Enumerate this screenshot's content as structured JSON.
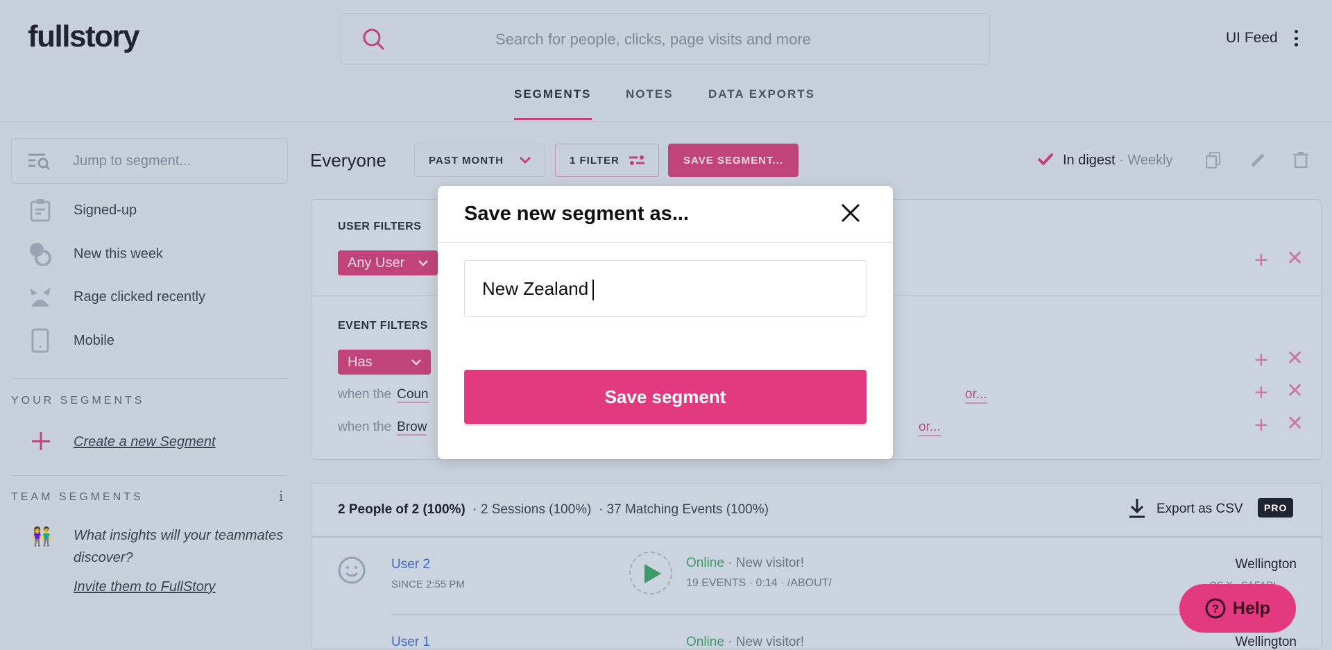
{
  "header": {
    "logo": "fullstory",
    "search_placeholder": "Search for people, clicks, page visits and more",
    "feed_label": "UI Feed"
  },
  "tabs": [
    {
      "label": "SEGMENTS",
      "active": true
    },
    {
      "label": "NOTES"
    },
    {
      "label": "DATA EXPORTS"
    }
  ],
  "sidebar": {
    "search_placeholder": "Jump to segment...",
    "items": [
      {
        "label": "Signed-up",
        "icon": "clipboard-icon"
      },
      {
        "label": "New this week",
        "icon": "baby-icon"
      },
      {
        "label": "Rage clicked recently",
        "icon": "angry-face-icon"
      },
      {
        "label": "Mobile",
        "icon": "phone-icon"
      }
    ],
    "your_segments": "YOUR SEGMENTS",
    "create_label": "Create a new Segment",
    "team_segments": "TEAM SEGMENTS",
    "info": "i",
    "team_prompt": "What insights will your teammates discover?",
    "invite_label": "Invite them to FullStory"
  },
  "segment": {
    "title": "Everyone",
    "date_range": "PAST MONTH",
    "filter_count": "1 FILTER",
    "save_label": "SAVE SEGMENT...",
    "digest": "In digest",
    "digest_freq": "· Weekly"
  },
  "filters": {
    "user_label": "USER FILTERS",
    "user_pill": "Any User",
    "event_label": "EVENT FILTERS",
    "event_pill": "Has",
    "rows": [
      {
        "prefix": "when the",
        "field": "Coun",
        "or": "or..."
      },
      {
        "prefix": "when the",
        "field": "Brow",
        "or": "or..."
      }
    ],
    "dot": "·"
  },
  "results": {
    "people": "2 People of 2 (100%)",
    "sessions": "· 2 Sessions (100%)",
    "events": "· 37 Matching Events (100%)",
    "export": "Export as CSV",
    "pro": "PRO",
    "users": [
      {
        "name": "User 2",
        "since": "SINCE 2:55 PM",
        "status": "Online",
        "note": "· New visitor!",
        "detail": "19 EVENTS · 0:14 · /ABOUT/",
        "city": "Wellington",
        "platform": "OS X · SAFARI"
      },
      {
        "name": "User 1",
        "status": "Online",
        "note": "· New visitor!",
        "city": "Wellington"
      }
    ]
  },
  "modal": {
    "title": "Save new segment as...",
    "input_value": "New Zealand",
    "button": "Save segment"
  },
  "help": {
    "label": "Help"
  },
  "colors": {
    "accent": "#e33a7f",
    "brand_pink": "#c0447a",
    "online": "#3f9a6a",
    "link": "#3a6fc4"
  }
}
